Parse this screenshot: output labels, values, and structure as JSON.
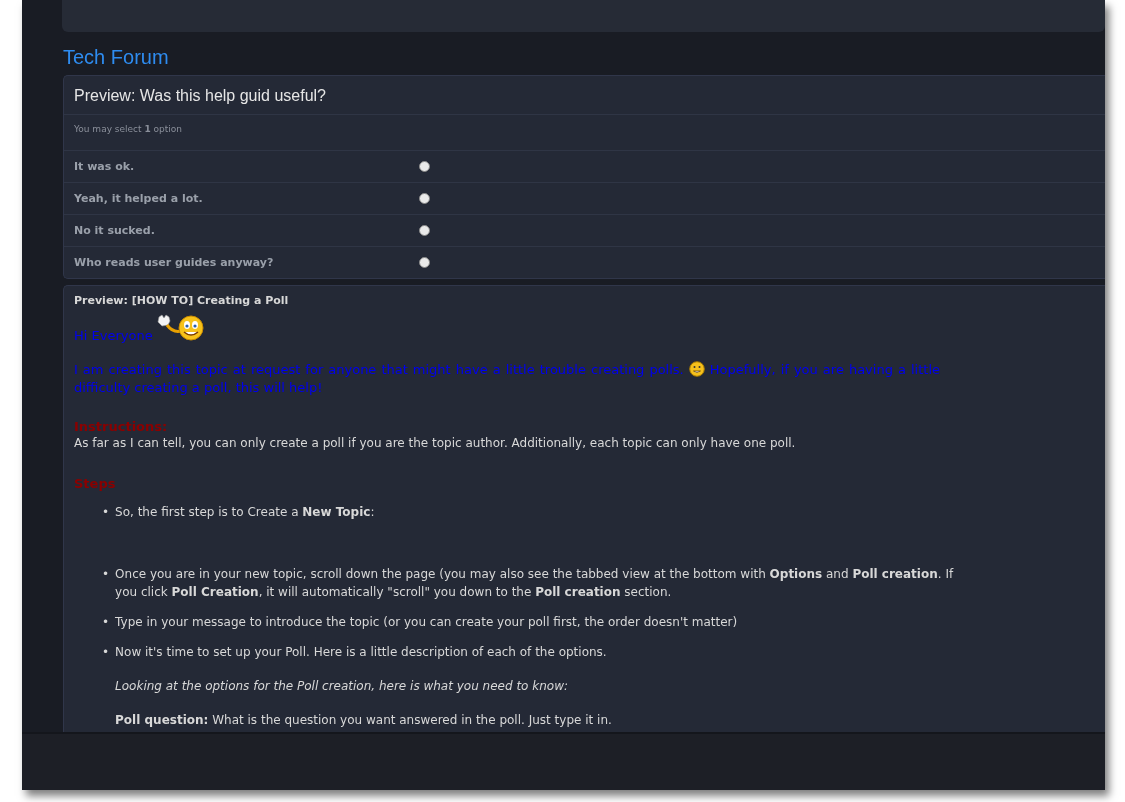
{
  "forum_title": "Tech Forum",
  "poll": {
    "title": "Preview: Was this help guid useful?",
    "hint": "You may select **1** option",
    "options": [
      {
        "label": "It was ok.",
        "selected": false
      },
      {
        "label": "Yeah, it helped a lot.",
        "selected": false
      },
      {
        "label": "No it sucked.",
        "selected": false
      },
      {
        "label": "Who reads user guides anyway?",
        "selected": false
      }
    ]
  },
  "post": {
    "title": "Preview: [HOW TO] Creating a Poll",
    "blocks": [
      {
        "kind": "greeting",
        "text": "Hi Everyone"
      },
      {
        "kind": "intro",
        "parts": [
          "I am creating this topic at request for anyone that might have a little trouble creating polls.",
          "Hopefully, if you are having a little difficulty creating a poll, this will help!"
        ]
      },
      {
        "kind": "heading",
        "text": "Instructions:"
      },
      {
        "kind": "paragraph",
        "text": "As far as I can tell, you can only create a poll if you are the topic author. Additionally, each topic can only have one poll."
      },
      {
        "kind": "heading",
        "text": "Steps"
      },
      {
        "kind": "list",
        "items": [
          {
            "bullet": "•",
            "text": "So, the first step is to Create a **New Topic**:"
          },
          {
            "bullet": "•",
            "text": "Once you are in your new topic, scroll down the page (you may also see the tabbed view at the bottom with **Options** and **Poll creation**. If you click **Poll Creation**, it will automatically \"scroll\" you down to the **Poll creation** section."
          },
          {
            "bullet": "•",
            "text": "Type in your message to introduce the topic (or you can create your poll first, the order doesn't matter)"
          },
          {
            "bullet": "•",
            "text": "Now it's time to set up your Poll. Here is a little description of each of the options.",
            "notes": [
              {
                "kind": "italic",
                "text": "Looking at the options for the Poll creation, here is what you need to know:"
              },
              {
                "kind": "plain",
                "text": "**Poll question:** What is the question you want answered in the poll. Just type it in."
              }
            ]
          }
        ]
      }
    ]
  }
}
